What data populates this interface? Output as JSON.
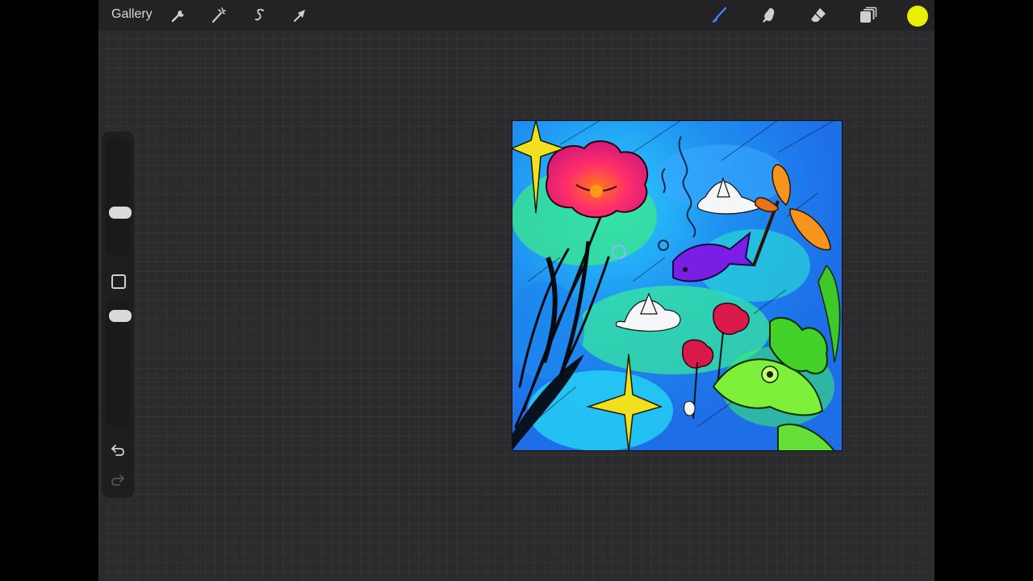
{
  "topbar": {
    "gallery_label": "Gallery",
    "left_tools": [
      {
        "name": "actions",
        "icon": "wrench-icon"
      },
      {
        "name": "adjustments",
        "icon": "magic-wand-icon"
      },
      {
        "name": "selection",
        "icon": "selection-s-icon"
      },
      {
        "name": "transform",
        "icon": "arrow-cursor-icon"
      }
    ],
    "right_tools": [
      {
        "name": "brush",
        "icon": "brush-icon",
        "active": true
      },
      {
        "name": "smudge",
        "icon": "smudge-finger-icon",
        "active": false
      },
      {
        "name": "eraser",
        "icon": "eraser-icon",
        "active": false
      },
      {
        "name": "layers",
        "icon": "layers-icon",
        "active": false
      }
    ],
    "current_color": "#e7f000"
  },
  "sidebar": {
    "brush_size_slider": {
      "icon": "slider-handle"
    },
    "opacity_slider": {
      "icon": "slider-handle"
    },
    "modify_button": {
      "icon": "square-icon"
    },
    "undo": {
      "icon": "undo-icon",
      "enabled": true
    },
    "redo": {
      "icon": "redo-icon",
      "enabled": false
    }
  },
  "colors": {
    "accent_brush": "#3b8cff",
    "app_background": "#2b2b2d",
    "topbar_background": "#232325"
  }
}
